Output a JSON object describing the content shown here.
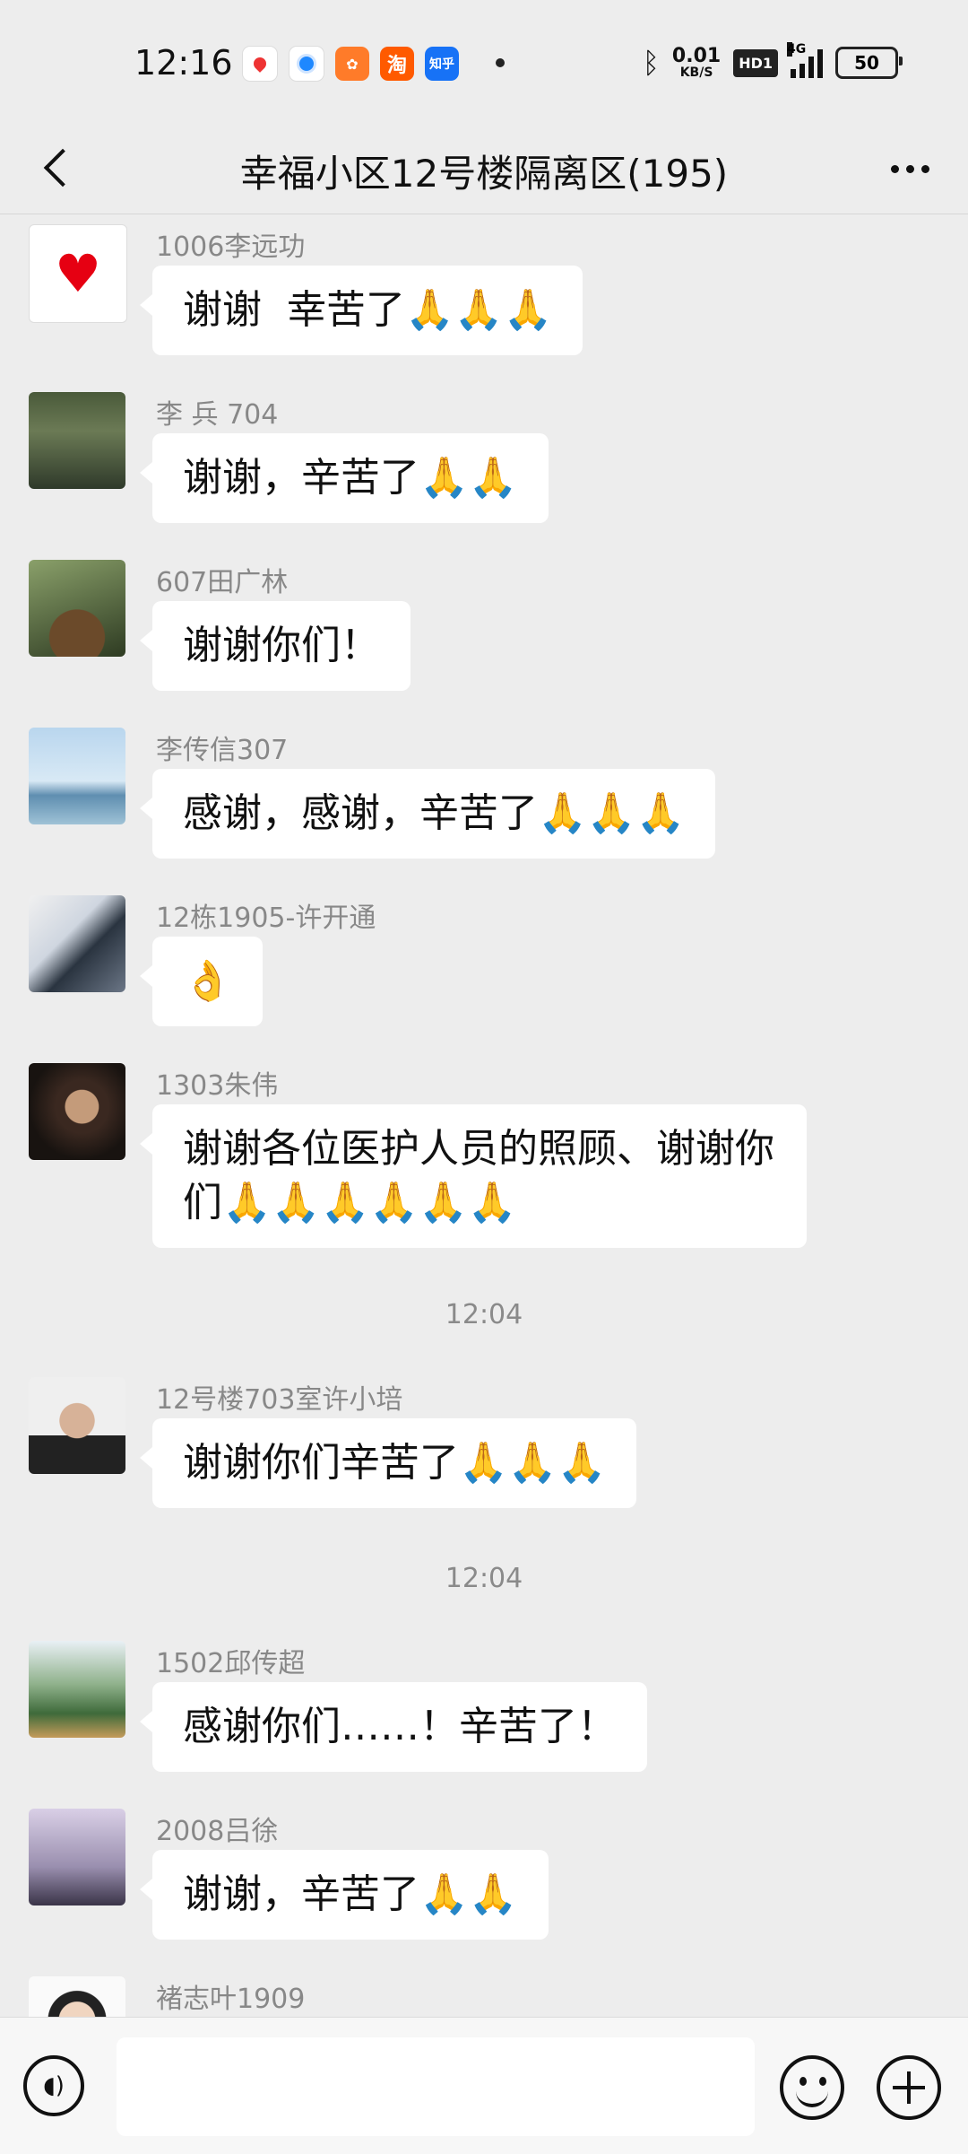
{
  "status_bar": {
    "time": "12:16",
    "apps": [
      "map-app-icon",
      "browser-app-icon",
      "uc-browser-icon",
      "taobao-icon",
      "zhihu-icon"
    ],
    "taobao_label": "淘",
    "zhihu_label": "知乎",
    "net_speed": "0.01",
    "net_unit": "KB/S",
    "hd_label": "HD1",
    "network_type": "4G",
    "battery": "50"
  },
  "header": {
    "title": "幸福小区12号楼隔离区(195)"
  },
  "messages": [
    {
      "name": "1006李远功",
      "text": "谢谢  幸苦了🙏🙏🙏"
    },
    {
      "name": "李  兵  704",
      "text": "谢谢，辛苦了🙏🙏"
    },
    {
      "name": "607田广林",
      "text": "谢谢你们！"
    },
    {
      "name": "李传信307",
      "text": "感谢，感谢，辛苦了🙏🙏🙏"
    },
    {
      "name": "12栋1905-许开通",
      "text": "👌"
    },
    {
      "name": "1303朱伟",
      "text": "谢谢各位医护人员的照顾、谢谢你们🙏🙏🙏🙏🙏🙏"
    },
    {
      "name": "12号楼703室许小培",
      "text": "谢谢你们辛苦了🙏🙏🙏"
    },
    {
      "name": "1502邱传超",
      "text": "感谢你们……！辛苦了！"
    },
    {
      "name": "2008吕徐",
      "text": "谢谢，辛苦了🙏🙏"
    },
    {
      "name": "褚志叶1909",
      "text": ""
    }
  ],
  "timestamps": [
    "12:04",
    "12:04"
  ],
  "input_bar": {
    "placeholder": ""
  }
}
